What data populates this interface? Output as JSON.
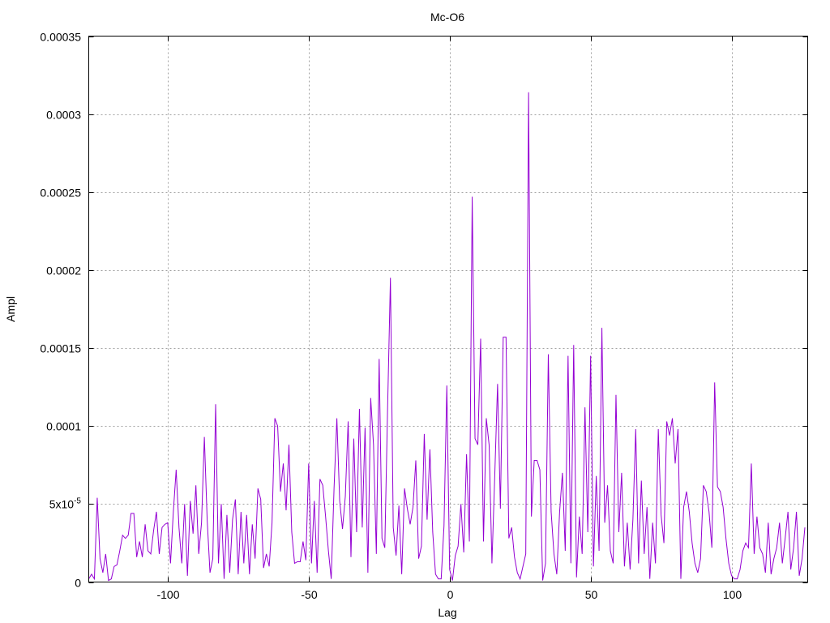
{
  "chart_data": {
    "type": "line",
    "title": "Mc-O6",
    "xlabel": "Lag",
    "ylabel": "Ampl",
    "xlim": [
      -128,
      127
    ],
    "ylim": [
      0,
      0.00035
    ],
    "xticks": [
      {
        "value": -100,
        "label": "-100"
      },
      {
        "value": -50,
        "label": "-50"
      },
      {
        "value": 0,
        "label": "0"
      },
      {
        "value": 50,
        "label": "50"
      },
      {
        "value": 100,
        "label": "100"
      }
    ],
    "yticks": [
      {
        "value": 0,
        "label": "0"
      },
      {
        "value": 5e-05,
        "label": "5x10",
        "exp": "-5"
      },
      {
        "value": 0.0001,
        "label": "0.0001"
      },
      {
        "value": 0.00015,
        "label": "0.00015"
      },
      {
        "value": 0.0002,
        "label": "0.0002"
      },
      {
        "value": 0.00025,
        "label": "0.00025"
      },
      {
        "value": 0.0003,
        "label": "0.0003"
      },
      {
        "value": 0.00035,
        "label": "0.00035"
      }
    ],
    "grid": true,
    "legend": "none",
    "color": "#9400d3",
    "series": [
      {
        "x_start": -128,
        "x_step": 1,
        "values": [
          2e-06,
          5e-06,
          2e-06,
          5.4e-05,
          1.5e-05,
          6e-06,
          1.8e-05,
          1e-06,
          2e-06,
          1e-05,
          1.1e-05,
          2e-05,
          3e-05,
          2.8e-05,
          3e-05,
          4.4e-05,
          4.4e-05,
          1.6e-05,
          2.6e-05,
          1.6e-05,
          3.7e-05,
          2e-05,
          1.8e-05,
          3.3e-05,
          4.5e-05,
          1.8e-05,
          3.5e-05,
          3.7e-05,
          3.8e-05,
          1.2e-05,
          4.5e-05,
          7.2e-05,
          3.5e-05,
          1.2e-05,
          5e-05,
          4e-06,
          5.2e-05,
          3.1e-05,
          6.2e-05,
          1.8e-05,
          3.8e-05,
          9.3e-05,
          4e-05,
          6e-06,
          1.5e-05,
          0.000114,
          1.2e-05,
          5e-05,
          2e-06,
          4.3e-05,
          6e-06,
          4e-05,
          5.3e-05,
          5e-06,
          4.5e-05,
          1.2e-05,
          4.3e-05,
          5e-06,
          3.7e-05,
          1.5e-05,
          6e-05,
          5.3e-05,
          9e-06,
          1.8e-05,
          1e-05,
          3.8e-05,
          0.000105,
          0.0001,
          5.8e-05,
          7.6e-05,
          4.6e-05,
          8.8e-05,
          3.2e-05,
          1.2e-05,
          1.3e-05,
          1.3e-05,
          2.6e-05,
          1.4e-05,
          7.6e-05,
          1.2e-05,
          5.2e-05,
          6e-06,
          6.6e-05,
          6.2e-05,
          4.2e-05,
          2e-05,
          2e-06,
          6e-05,
          0.000105,
          5.2e-05,
          3.4e-05,
          5.5e-05,
          0.000103,
          1.6e-05,
          9.2e-05,
          3.2e-05,
          0.000111,
          3.5e-05,
          9.9e-05,
          6e-06,
          0.000118,
          8.8e-05,
          1.8e-05,
          0.000143,
          2.8e-05,
          2.2e-05,
          0.000112,
          0.000195,
          3.5e-05,
          1.7e-05,
          4.9e-05,
          5e-06,
          6e-05,
          4.7e-05,
          3.7e-05,
          4.8e-05,
          7.8e-05,
          1.5e-05,
          2.3e-05,
          9.5e-05,
          4e-05,
          8.5e-05,
          3.2e-05,
          5e-06,
          2e-06,
          2e-06,
          3.6e-05,
          0.000126,
          8e-06,
          1e-06,
          1.7e-05,
          2.3e-05,
          5e-05,
          1.9e-05,
          8.2e-05,
          2.6e-05,
          0.000247,
          9.2e-05,
          8.8e-05,
          0.000156,
          2.6e-05,
          0.000105,
          8.8e-05,
          1.2e-05,
          6.8e-05,
          0.000127,
          4.7e-05,
          0.000157,
          0.000157,
          2.8e-05,
          3.5e-05,
          1.6e-05,
          6e-06,
          2e-06,
          1e-05,
          1.8e-05,
          0.000314,
          4.2e-05,
          7.8e-05,
          7.8e-05,
          7.2e-05,
          1e-06,
          1.2e-05,
          0.000146,
          4.5e-05,
          1.8e-05,
          5e-06,
          4.5e-05,
          7e-05,
          2e-05,
          0.000145,
          1.2e-05,
          0.000152,
          3e-06,
          4.2e-05,
          1.8e-05,
          0.000112,
          3.2e-05,
          0.000145,
          1e-05,
          6.8e-05,
          2e-05,
          0.000163,
          3.8e-05,
          6.2e-05,
          2e-05,
          1.2e-05,
          0.00012,
          3.2e-05,
          7e-05,
          1e-05,
          3.8e-05,
          8e-06,
          4e-05,
          9.8e-05,
          1.2e-05,
          6.5e-05,
          1.8e-05,
          4.8e-05,
          2e-06,
          3.8e-05,
          1.2e-05,
          9.8e-05,
          4.3e-05,
          2.5e-05,
          0.000103,
          9.4e-05,
          0.000105,
          7.6e-05,
          9.8e-05,
          2e-06,
          4.8e-05,
          5.8e-05,
          4.5e-05,
          2.5e-05,
          1.2e-05,
          6e-06,
          1.5e-05,
          6.2e-05,
          5.8e-05,
          4.5e-05,
          2.2e-05,
          0.000128,
          6.1e-05,
          5.8e-05,
          4.8e-05,
          2.8e-05,
          1.2e-05,
          4e-06,
          2e-06,
          2e-06,
          8e-06,
          2e-05,
          2.5e-05,
          2.2e-05,
          7.6e-05,
          1.8e-05,
          4.2e-05,
          2.2e-05,
          1.8e-05,
          6e-06,
          3.8e-05,
          5e-06,
          1.5e-05,
          2.2e-05,
          3.8e-05,
          1.2e-05,
          2.8e-05,
          4.5e-05,
          8e-06,
          2.2e-05,
          4.5e-05,
          4e-06,
          1.5e-05,
          3.5e-05
        ]
      }
    ]
  }
}
